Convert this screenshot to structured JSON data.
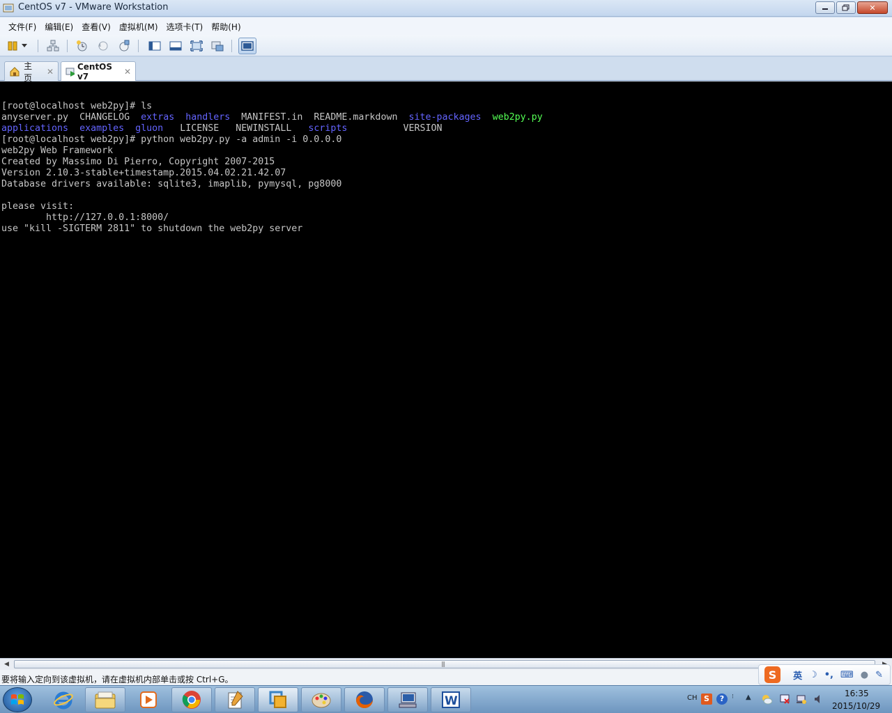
{
  "window": {
    "title": "CentOS v7 - VMware Workstation"
  },
  "menu": [
    "文件(F)",
    "编辑(E)",
    "查看(V)",
    "虚拟机(M)",
    "选项卡(T)",
    "帮助(H)"
  ],
  "tabs": [
    {
      "label": "主页"
    },
    {
      "label": "CentOS v7"
    }
  ],
  "console": {
    "line1": "[root@localhost web2py]# ls",
    "ls_row1": {
      "anyserver": "anyserver.py",
      "changelog": "CHANGELOG",
      "extras": "extras",
      "handlers": "handlers",
      "manifest": "MANIFEST.in",
      "readme": "README.markdown",
      "sitepackages": "site-packages",
      "web2py": "web2py.py"
    },
    "ls_row2": {
      "applications": "applications",
      "examples": "examples",
      "gluon": "gluon",
      "license": "LICENSE",
      "newinstall": "NEWINSTALL",
      "scripts": "scripts",
      "version": "VERSION"
    },
    "line4": "[root@localhost web2py]# python web2py.py -a admin -i 0.0.0.0",
    "line5": "web2py Web Framework",
    "line6": "Created by Massimo Di Pierro, Copyright 2007-2015",
    "line7": "Version 2.10.3-stable+timestamp.2015.04.02.21.42.07",
    "line8": "Database drivers available: sqlite3, imaplib, pymysql, pg8000",
    "line9": "",
    "line10": "please visit:",
    "line11": "        http://127.0.0.1:8000/",
    "line12": "use \"kill -SIGTERM 2811\" to shutdown the web2py server"
  },
  "status": {
    "message": "要将输入定向到该虚拟机，请在虚拟机内部单击或按 Ctrl+G。"
  },
  "ime": {
    "lang": "英"
  },
  "tray": {
    "lang": "CH",
    "time": "16:35",
    "date": "2015/10/29"
  },
  "colors": {
    "console_bg": "#000000",
    "console_fg": "#c6c6c6",
    "dir_blue": "#6464ff",
    "exec_green": "#54ff54"
  }
}
